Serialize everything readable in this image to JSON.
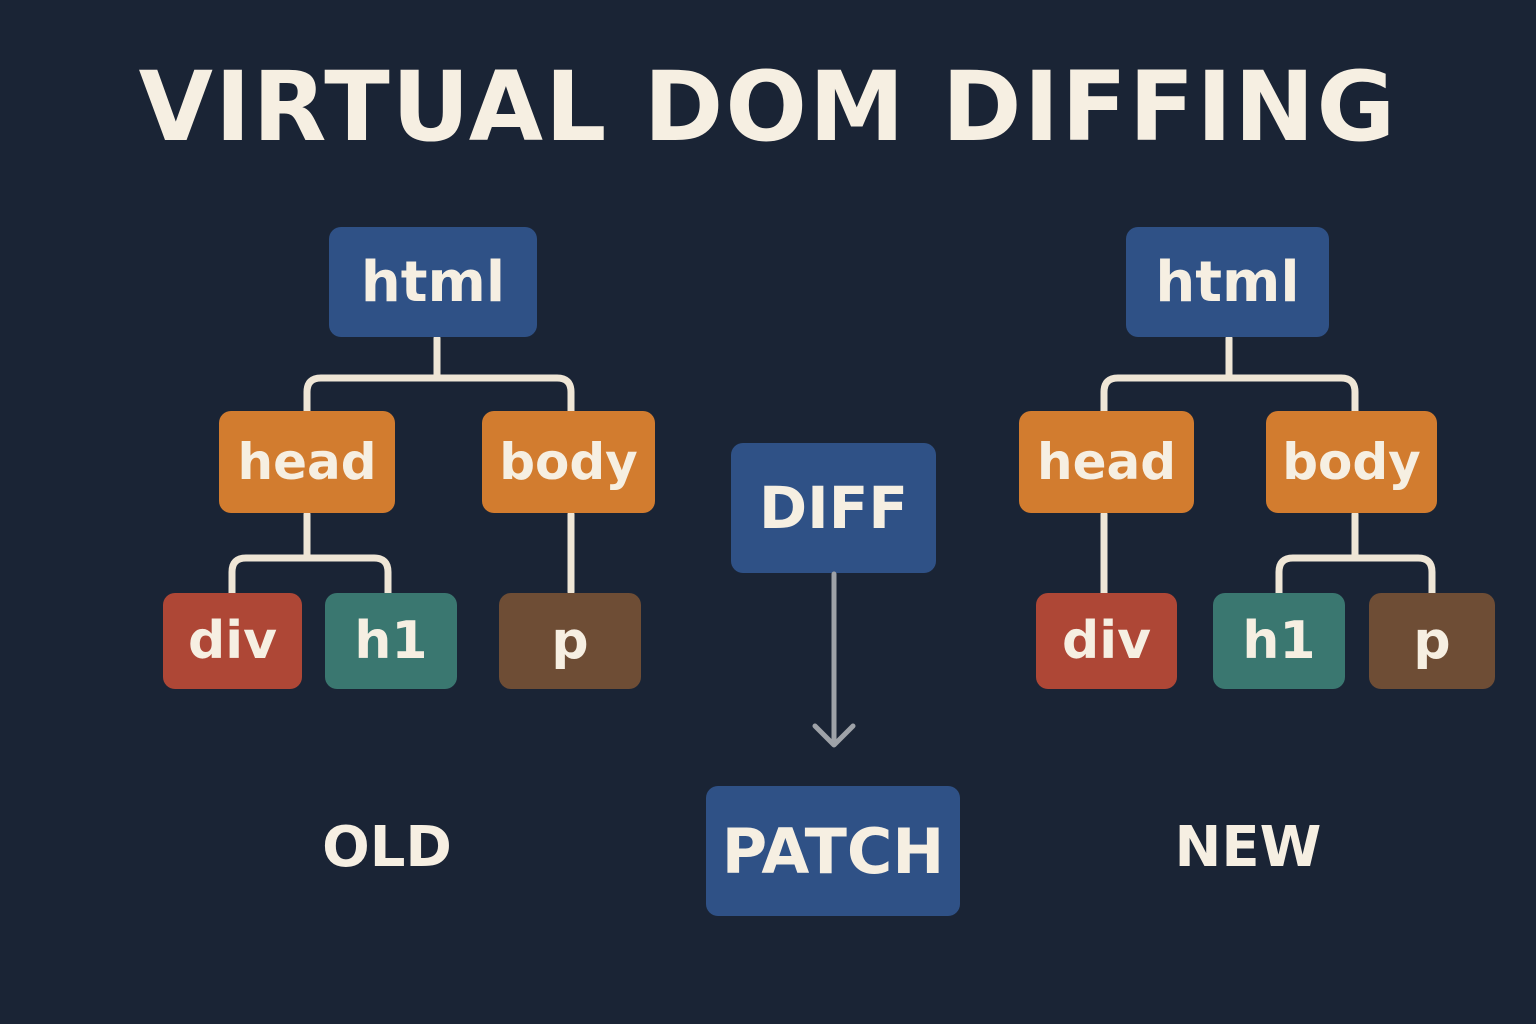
{
  "title": "VIRTUAL DOM DIFFING",
  "old_tree": {
    "label": "OLD",
    "root": "html",
    "head": "head",
    "body": "body",
    "div": "div",
    "h1": "h1",
    "p": "p"
  },
  "new_tree": {
    "label": "NEW",
    "root": "html",
    "head": "head",
    "body": "body",
    "div": "div",
    "h1": "h1",
    "p": "p"
  },
  "process": {
    "diff": "DIFF",
    "patch": "PATCH"
  },
  "colors": {
    "background": "#1a2435",
    "root_node": "#2f5186",
    "mid_node": "#d27c2f",
    "div_node": "#ae4736",
    "h1_node": "#3a7770",
    "p_node": "#6e4d35",
    "text": "#f6efe2",
    "connector": "#efe6d6",
    "arrow": "#9ea2a8"
  }
}
